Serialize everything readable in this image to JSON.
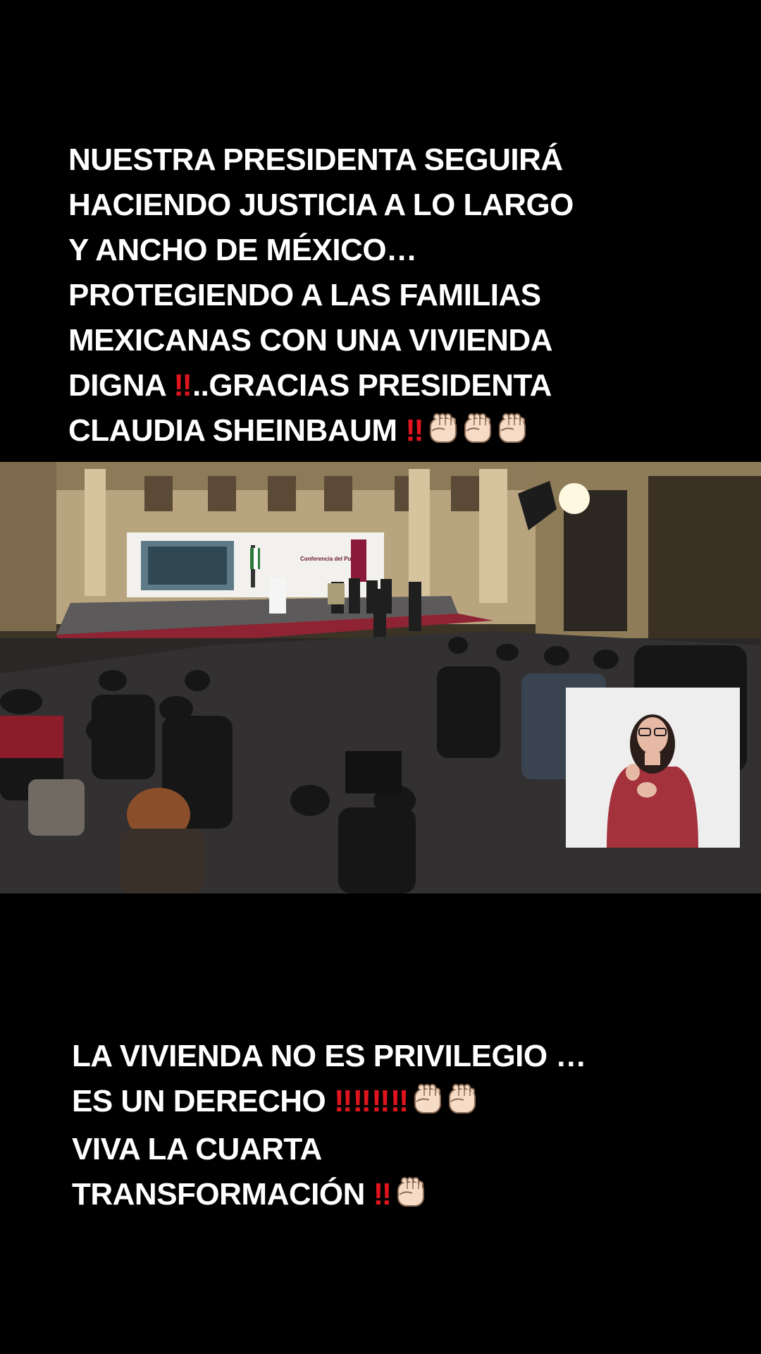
{
  "top_caption": {
    "lines": [
      "NUESTRA PRESIDENTA SEGUIRÁ",
      "HACIENDO JUSTICIA A LO LARGO",
      "Y ANCHO DE MÉXICO…",
      "PROTEGIENDO A LAS FAMILIAS",
      "MEXICANAS CON UNA VIVIENDA"
    ],
    "line6_a": "DIGNA ",
    "line6_b": "..GRACIAS PRESIDENTA",
    "line7": "CLAUDIA SHEINBAUM "
  },
  "bottom_caption": {
    "line1": "LA VIVIENDA NO ES PRIVILEGIO …",
    "line2": "ES UN DERECHO ",
    "line3": "VIVA LA CUARTA",
    "line4": "TRANSFORMACIÓN "
  },
  "emoji": {
    "double_exclamation": "‼",
    "raised_fist": "raised-fist-icon"
  },
  "video": {
    "screen_sign": "Conferencia del Pueblo"
  },
  "colors": {
    "background": "#000000",
    "text": "#ffffff",
    "exclamation": "#e0141e",
    "fist_skin": "#f6dcc6",
    "wall": "#c9b99a"
  }
}
